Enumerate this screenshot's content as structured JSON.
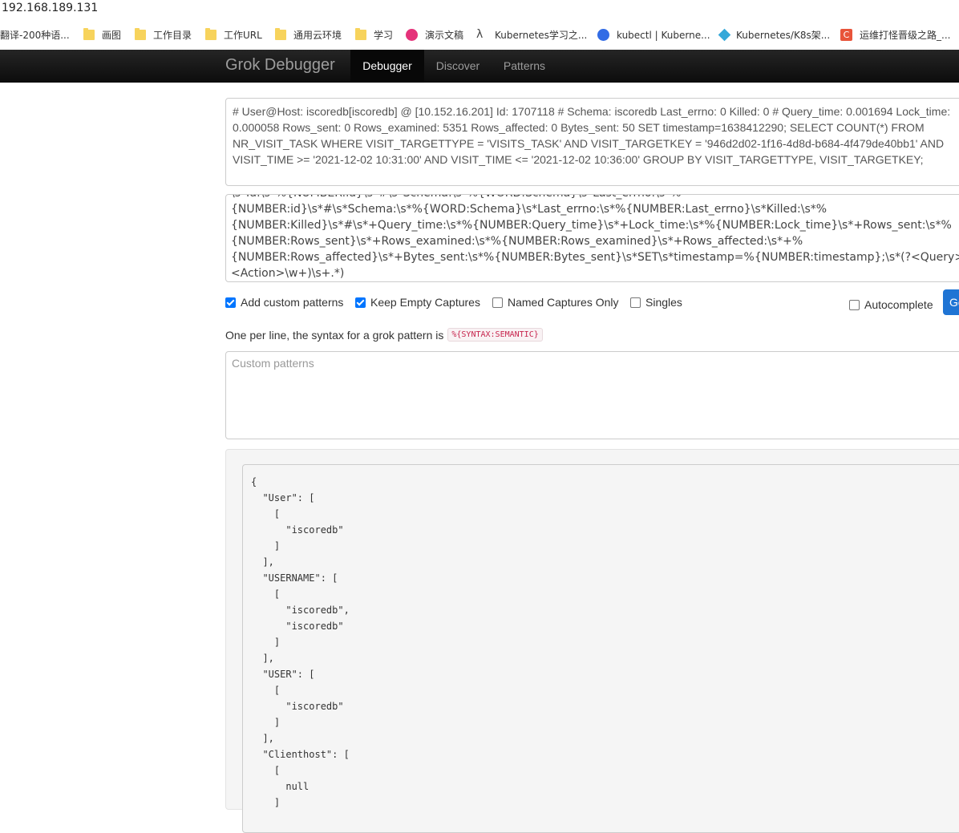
{
  "browser": {
    "address": "192.168.189.131",
    "bookmarks": [
      {
        "label": "翻译-200种语...",
        "icon": "none"
      },
      {
        "label": "画图",
        "icon": "folder-icon"
      },
      {
        "label": "工作目录",
        "icon": "folder-icon"
      },
      {
        "label": "工作URL",
        "icon": "folder-icon"
      },
      {
        "label": "通用云环境",
        "icon": "folder-icon"
      },
      {
        "label": "学习",
        "icon": "folder-icon"
      },
      {
        "label": "演示文稿",
        "icon": "slides-icon"
      },
      {
        "label": "Kubernetes学习之...",
        "icon": "lambda-icon"
      },
      {
        "label": "kubectl | Kuberne...",
        "icon": "kubernetes-icon"
      },
      {
        "label": "Kubernetes/K8s架...",
        "icon": "diamond-icon"
      },
      {
        "label": "运维打怪晋级之路_...",
        "icon": "csdn-icon"
      }
    ]
  },
  "navbar": {
    "brand": "Grok Debugger",
    "items": [
      {
        "label": "Debugger",
        "active": true
      },
      {
        "label": "Discover",
        "active": false
      },
      {
        "label": "Patterns",
        "active": false
      }
    ]
  },
  "sample": {
    "lines": [
      "# User@Host: iscoredb[iscoredb] @  [10.152.16.201]  Id: 1707118 # Schema: iscoredb  Last_errno: 0  Killed: 0 # Query_time: 0.001694  Lock_time:",
      "0.000058  Rows_sent: 0  Rows_examined: 5351  Rows_affected: 0  Bytes_sent: 50 SET timestamp=1638412290; SELECT COUNT(*) FROM",
      "NR_VISIT_TASK WHERE VISIT_TARGETTYPE = 'VISITS_TASK'  AND VISIT_TARGETKEY = '946d2d02-1f16-4d8d-b684-4f479de40bb1'  AND",
      "VISIT_TIME >= '2021-12-02 10:31:00' AND VISIT_TIME <= '2021-12-02 10:36:00' GROUP BY VISIT_TARGETTYPE, VISIT_TARGETKEY;"
    ]
  },
  "pattern": {
    "lines": [
      "\\s*Id:\\s*%{NUMBER:id}\\s*#\\s*Schema:\\s*%{WORD:Schema}\\s*Last_errno:\\s*%",
      "{NUMBER:id}\\s*#\\s*Schema:\\s*%{WORD:Schema}\\s*Last_errno:\\s*%{NUMBER:Last_errno}\\s*Killed:\\s*%",
      "{NUMBER:Killed}\\s*#\\s*+Query_time:\\s*%{NUMBER:Query_time}\\s*+Lock_time:\\s*%{NUMBER:Lock_time}\\s*+Rows_sent:\\s*%",
      "{NUMBER:Rows_sent}\\s*+Rows_examined:\\s*%{NUMBER:Rows_examined}\\s*+Rows_affected:\\s*+%",
      "{NUMBER:Rows_affected}\\s*+Bytes_sent:\\s*%{NUMBER:Bytes_sent}\\s*SET\\s*timestamp=%{NUMBER:timestamp};\\s*(?<Query>(?",
      "<Action>\\w+)\\s+.*)"
    ]
  },
  "options": {
    "add_custom_patterns": {
      "label": "Add custom patterns",
      "checked": true
    },
    "keep_empty_captures": {
      "label": "Keep Empty Captures",
      "checked": true
    },
    "named_captures_only": {
      "label": "Named Captures Only",
      "checked": false
    },
    "singles": {
      "label": "Singles",
      "checked": false
    },
    "autocomplete": {
      "label": "Autocomplete",
      "checked": false
    },
    "go_label": "Go"
  },
  "help": {
    "text": "One per line, the syntax for a grok pattern is",
    "syntax": "%{SYNTAX:SEMANTIC}"
  },
  "custom_patterns": {
    "placeholder": "Custom patterns"
  },
  "output": {
    "json_lines": [
      "{",
      "  \"User\": [",
      "    [",
      "      \"iscoredb\"",
      "    ]",
      "  ],",
      "  \"USERNAME\": [",
      "    [",
      "      \"iscoredb\",",
      "      \"iscoredb\"",
      "    ]",
      "  ],",
      "  \"USER\": [",
      "    [",
      "      \"iscoredb\"",
      "    ]",
      "  ],",
      "  \"Clienthost\": [",
      "    [",
      "      null",
      "    ]"
    ]
  },
  "colors": {
    "accent": "#0075ff",
    "navbar": "#111111",
    "go_button": "#1f74d4"
  }
}
